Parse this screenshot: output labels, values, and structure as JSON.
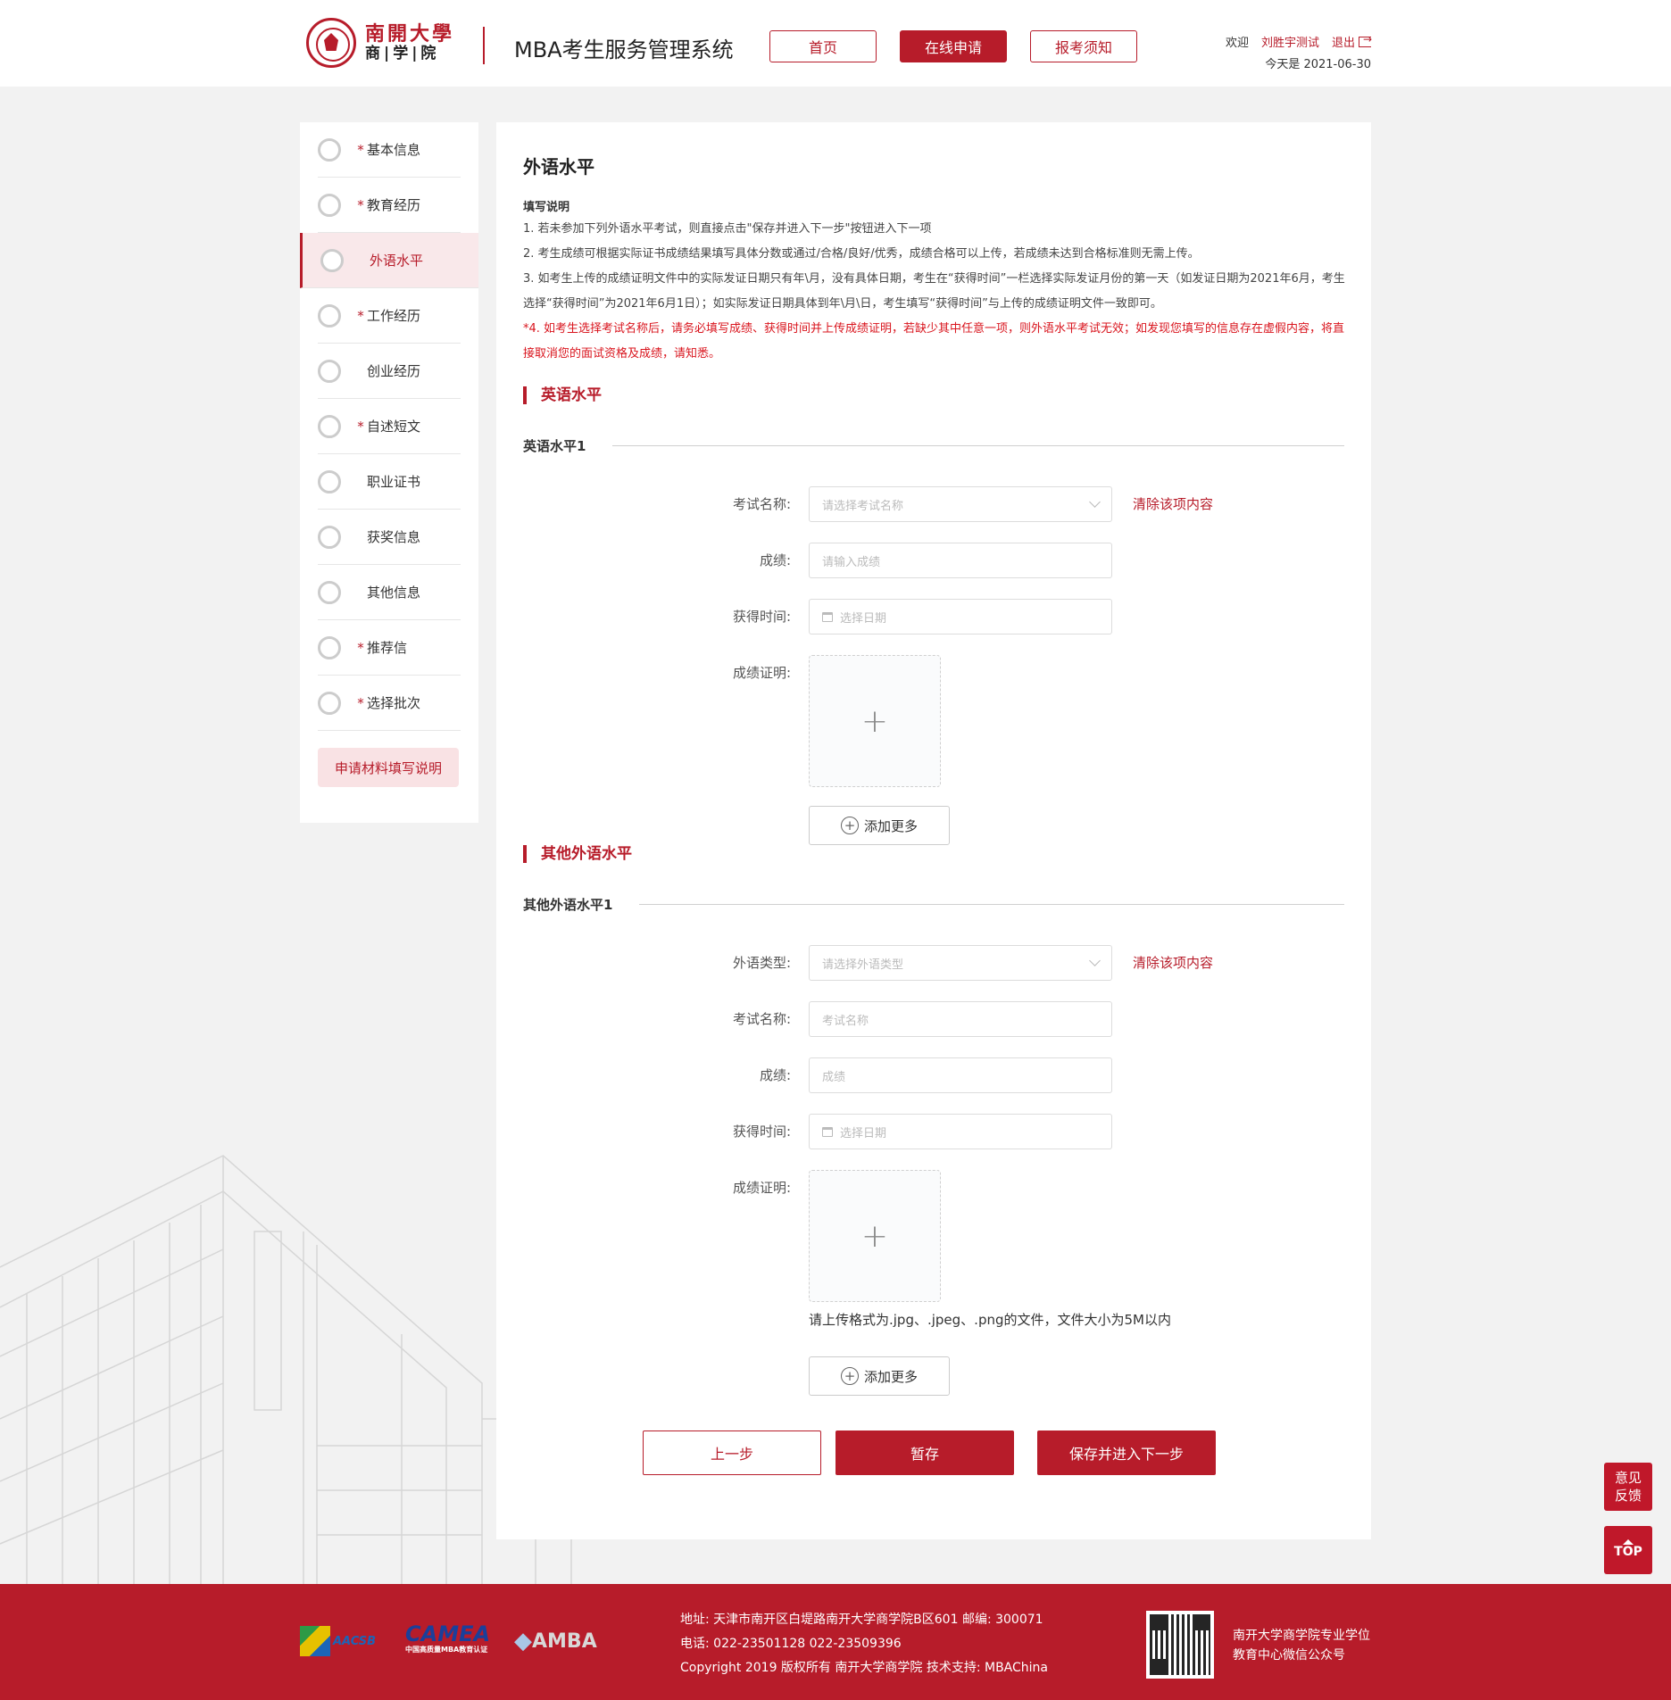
{
  "header": {
    "logo_line1": "南開大學",
    "logo_line2": "商|学|院",
    "system_title": "MBA考生服务管理系统",
    "nav": [
      {
        "label": "首页",
        "active": false
      },
      {
        "label": "在线申请",
        "active": true
      },
      {
        "label": "报考须知",
        "active": false
      }
    ],
    "welcome": "欢迎",
    "username": "刘胜宇测试",
    "logout": "退出",
    "today": "今天是  2021-06-30"
  },
  "sidebar": {
    "items": [
      {
        "label": "基本信息",
        "required": "*"
      },
      {
        "label": "教育经历",
        "required": "*"
      },
      {
        "label": "外语水平",
        "required": ""
      },
      {
        "label": "工作经历",
        "required": "*"
      },
      {
        "label": "创业经历",
        "required": ""
      },
      {
        "label": "自述短文",
        "required": "*"
      },
      {
        "label": "职业证书",
        "required": ""
      },
      {
        "label": "获奖信息",
        "required": ""
      },
      {
        "label": "其他信息",
        "required": ""
      },
      {
        "label": "推荐信",
        "required": "*"
      },
      {
        "label": "选择批次",
        "required": "*"
      }
    ],
    "active_index": 2,
    "help_button": "申请材料填写说明"
  },
  "main": {
    "title": "外语水平",
    "notes_title": "填写说明",
    "notes": [
      "1. 若未参加下列外语水平考试，则直接点击\"保存并进入下一步\"按钮进入下一项",
      "2. 考生成绩可根据实际证书成绩结果填写具体分数或通过/合格/良好/优秀，成绩合格可以上传，若成绩未达到合格标准则无需上传。",
      "3. 如考生上传的成绩证明文件中的实际发证日期只有年\\月，没有具体日期，考生在“获得时间”一栏选择实际发证月份的第一天（如发证日期为2021年6月，考生选择“获得时间”为2021年6月1日）；如实际发证日期具体到年\\月\\日，考生填写“获得时间”与上传的成绩证明文件一致即可。",
      "*4. 如考生选择考试名称后，请务必填写成绩、获得时间并上传成绩证明，若缺少其中任意一项，则外语水平考试无效；如发现您填写的信息存在虚假内容，将直接取消您的面试资格及成绩，请知悉。"
    ],
    "english": {
      "section": "英语水平",
      "sub": "英语水平1",
      "exam_label": "考试名称:",
      "exam_placeholder": "请选择考试名称",
      "clear": "清除该项内容",
      "score_label": "成绩:",
      "score_placeholder": "请输入成绩",
      "date_label": "获得时间:",
      "date_placeholder": "选择日期",
      "proof_label": "成绩证明:",
      "add_more": "添加更多"
    },
    "other": {
      "section": "其他外语水平",
      "sub": "其他外语水平1",
      "type_label": "外语类型:",
      "type_placeholder": "请选择外语类型",
      "clear": "清除该项内容",
      "exam_label": "考试名称:",
      "exam_placeholder": "考试名称",
      "score_label": "成绩:",
      "score_placeholder": "成绩",
      "date_label": "获得时间:",
      "date_placeholder": "选择日期",
      "proof_label": "成绩证明:",
      "upload_hint": "请上传格式为.jpg、.jpeg、.png的文件，文件大小为5M以内",
      "add_more": "添加更多"
    },
    "buttons": {
      "prev": "上一步",
      "save": "暂存",
      "save_next": "保存并进入下一步"
    },
    "upload_plus": "+"
  },
  "floating": {
    "feedback": "意见反馈",
    "top": "TOP"
  },
  "footer": {
    "aacsb": "AACSB",
    "camea": "CAMEA",
    "camea_sub": "中国高质量MBA教育认证",
    "amba": "AMBA",
    "address": "地址:  天津市南开区白堤路南开大学商学院B区601        邮编:  300071",
    "phone": "电话:  022-23501128  022-23509396",
    "copyright": "Copyright 2019 版权所有  南开大学商学院  技术支持:  MBAChina",
    "wechat_line1": "南开大学商学院专业学位",
    "wechat_line2": "教育中心微信公众号"
  },
  "colors": {
    "brand": "#b71c2a",
    "warning_text": "#d9141d"
  }
}
